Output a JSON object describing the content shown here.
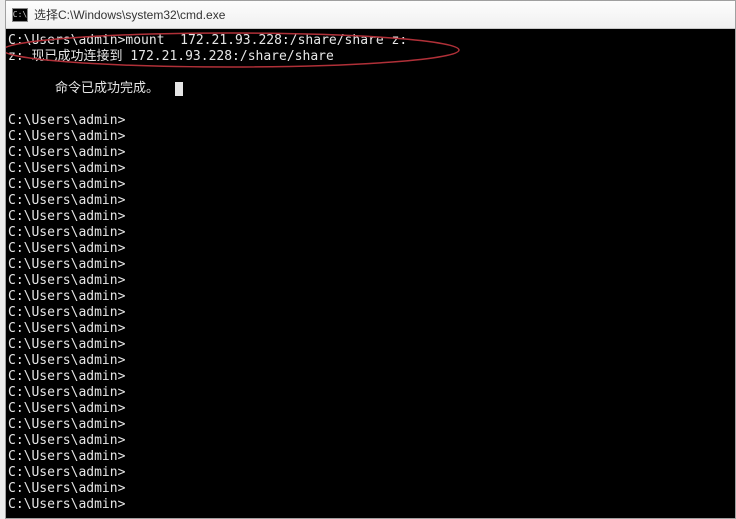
{
  "titlebar": {
    "icon_label": "C:\\",
    "title": "选择C:\\Windows\\system32\\cmd.exe"
  },
  "terminal": {
    "cmd_line": "C:\\Users\\admin>mount  172.21.93.228:/share/share z:",
    "status_line": "z: 现已成功连接到 172.21.93.228:/share/share",
    "blank_1": "",
    "success_line": "命令已成功完成。",
    "blank_2": "",
    "prompt": "C:\\Users\\admin>",
    "prompt_count": 25
  },
  "annotation": {
    "color": "#b03038"
  }
}
